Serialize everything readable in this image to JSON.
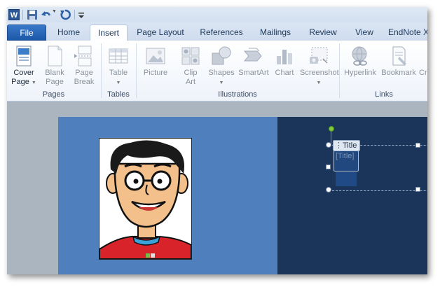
{
  "app": {
    "name": "Microsoft Word",
    "icon_letter": "W"
  },
  "qat": {
    "icons": [
      "word-icon",
      "save-icon",
      "undo-icon",
      "redo-icon",
      "customize-icon"
    ]
  },
  "tabs": [
    {
      "label": "File",
      "state": "file"
    },
    {
      "label": "Home",
      "state": "normal"
    },
    {
      "label": "Insert",
      "state": "active"
    },
    {
      "label": "Page Layout",
      "state": "normal"
    },
    {
      "label": "References",
      "state": "normal"
    },
    {
      "label": "Mailings",
      "state": "normal"
    },
    {
      "label": "Review",
      "state": "normal"
    },
    {
      "label": "View",
      "state": "normal"
    },
    {
      "label": "EndNote X",
      "state": "normal"
    }
  ],
  "ribbon": {
    "pages": {
      "label": "Pages",
      "buttons": [
        {
          "line1": "Cover",
          "line2": "Page",
          "icon": "cover-page-icon",
          "enabled": true,
          "dropdown": true
        },
        {
          "line1": "Blank",
          "line2": "Page",
          "icon": "blank-page-icon",
          "enabled": false
        },
        {
          "line1": "Page",
          "line2": "Break",
          "icon": "page-break-icon",
          "enabled": false
        }
      ]
    },
    "tables": {
      "label": "Tables",
      "buttons": [
        {
          "line1": "Table",
          "line2": "",
          "icon": "table-icon",
          "enabled": false,
          "dropdown": true
        }
      ]
    },
    "illustrations": {
      "label": "Illustrations",
      "buttons": [
        {
          "line1": "Picture",
          "line2": "",
          "icon": "picture-icon",
          "enabled": false
        },
        {
          "line1": "Clip",
          "line2": "Art",
          "icon": "clip-art-icon",
          "enabled": false
        },
        {
          "line1": "Shapes",
          "line2": "",
          "icon": "shapes-icon",
          "enabled": false,
          "dropdown": true
        },
        {
          "line1": "SmartArt",
          "line2": "",
          "icon": "smartart-icon",
          "enabled": false
        },
        {
          "line1": "Chart",
          "line2": "",
          "icon": "chart-icon",
          "enabled": false
        },
        {
          "line1": "Screenshot",
          "line2": "",
          "icon": "screenshot-icon",
          "enabled": false,
          "dropdown": true
        }
      ]
    },
    "links": {
      "label": "Links",
      "buttons": [
        {
          "line1": "Hyperlink",
          "line2": "",
          "icon": "hyperlink-icon",
          "enabled": false
        },
        {
          "line1": "Bookmark",
          "line2": "",
          "icon": "bookmark-icon",
          "enabled": false
        },
        {
          "line1": "Cr",
          "line2": "",
          "icon": "cross-reference-icon",
          "enabled": false
        }
      ]
    }
  },
  "document": {
    "title_tag": "Title",
    "title_placeholder": "[Title]",
    "colors": {
      "slide_left": "#4f7fbd",
      "slide_right": "#1b3459",
      "accent": "#2b5797"
    }
  }
}
